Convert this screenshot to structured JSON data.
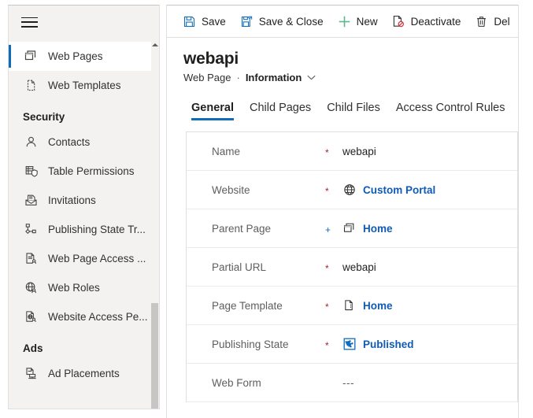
{
  "sidebar": {
    "menu_icon": "hamburger-icon",
    "items": [
      {
        "label": "Web Pages",
        "icon": "web-pages-icon",
        "type": "item",
        "selected": true
      },
      {
        "label": "Web Templates",
        "icon": "web-template-icon",
        "type": "item",
        "selected": false
      },
      {
        "label": "Security",
        "icon": "",
        "type": "group",
        "selected": false
      },
      {
        "label": "Contacts",
        "icon": "contact-person-icon",
        "type": "item",
        "selected": false
      },
      {
        "label": "Table  Permissions",
        "icon": "table-permissions-icon",
        "type": "item",
        "selected": false
      },
      {
        "label": "Invitations",
        "icon": "invitation-envelope-icon",
        "type": "item",
        "selected": false
      },
      {
        "label": "Publishing State Tr...",
        "icon": "publishing-state-transition-icon",
        "type": "item",
        "selected": false
      },
      {
        "label": "Web Page Access ...",
        "icon": "web-page-access-icon",
        "type": "item",
        "selected": false
      },
      {
        "label": "Web Roles",
        "icon": "web-roles-globe-icon",
        "type": "item",
        "selected": false
      },
      {
        "label": "Website Access Pe...",
        "icon": "website-access-icon",
        "type": "item",
        "selected": false
      },
      {
        "label": "Ads",
        "icon": "",
        "type": "group",
        "selected": false
      },
      {
        "label": "Ad Placements",
        "icon": "ad-placements-icon",
        "type": "item",
        "selected": false
      }
    ]
  },
  "commandbar": {
    "buttons": [
      {
        "label": "Save",
        "icon": "save-icon"
      },
      {
        "label": "Save & Close",
        "icon": "save-and-close-icon"
      },
      {
        "label": "New",
        "icon": "plus-icon"
      },
      {
        "label": "Deactivate",
        "icon": "deactivate-icon"
      },
      {
        "label": "Del",
        "icon": "delete-trash-icon"
      }
    ]
  },
  "record": {
    "title": "webapi",
    "entity": "Web Page",
    "separator": "·",
    "form_name": "Information"
  },
  "tabs": [
    {
      "label": "General",
      "active": true
    },
    {
      "label": "Child Pages",
      "active": false
    },
    {
      "label": "Child Files",
      "active": false
    },
    {
      "label": "Access Control Rules",
      "active": false
    }
  ],
  "form": {
    "fields": [
      {
        "label": "Name",
        "marker": "*",
        "marker_type": "required",
        "value": "webapi",
        "icon": "",
        "is_link": false
      },
      {
        "label": "Website",
        "marker": "*",
        "marker_type": "required",
        "value": "Custom Portal",
        "icon": "globe-icon",
        "is_link": true
      },
      {
        "label": "Parent Page",
        "marker": "+",
        "marker_type": "optional",
        "value": "Home",
        "icon": "web-pages-icon",
        "is_link": true
      },
      {
        "label": "Partial URL",
        "marker": "*",
        "marker_type": "required",
        "value": "webapi",
        "icon": "",
        "is_link": false
      },
      {
        "label": "Page Template",
        "marker": "*",
        "marker_type": "required",
        "value": "Home",
        "icon": "page-template-icon",
        "is_link": true
      },
      {
        "label": "Publishing State",
        "marker": "*",
        "marker_type": "required",
        "value": "Published",
        "icon": "publishing-state-icon",
        "is_link": true
      },
      {
        "label": "Web Form",
        "marker": "",
        "marker_type": "none",
        "value": "---",
        "icon": "",
        "is_link": false
      }
    ]
  },
  "colors": {
    "accent": "#0f6cbd",
    "link": "#0f5bb5",
    "required": "#a4262c",
    "nav_background": "#f3f2f1",
    "border": "#e1dfdd"
  }
}
